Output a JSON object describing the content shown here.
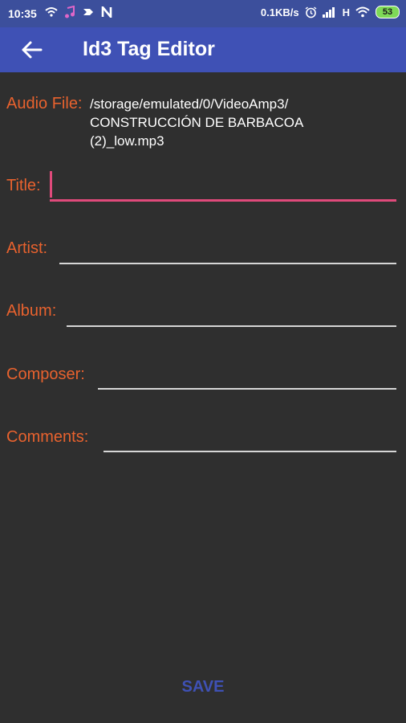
{
  "status_bar": {
    "time": "10:35",
    "network_speed": "0.1KB/s",
    "network_type": "H",
    "battery": "53"
  },
  "app_bar": {
    "title": "Id3 Tag Editor",
    "back_icon": "arrow-back-icon"
  },
  "form": {
    "audio_file_label": "Audio File:",
    "audio_file_path_line1": "/storage/emulated/0/VideoAmp3/",
    "audio_file_path_line2": "CONSTRUCCIÓN DE BARBACOA",
    "audio_file_path_line3": "(2)_low.mp3",
    "title_label": "Title:",
    "title_value": "",
    "artist_label": "Artist:",
    "artist_value": "",
    "album_label": "Album:",
    "album_value": "",
    "composer_label": "Composer:",
    "composer_value": "",
    "comments_label": "Comments:",
    "comments_value": ""
  },
  "actions": {
    "save_label": "SAVE"
  },
  "colors": {
    "status_bar": "#3c4f9c",
    "app_bar": "#3f51b5",
    "background": "#2f2f2f",
    "label": "#e8622e",
    "active_field": "#e04a7b",
    "save": "#3f51b5"
  }
}
